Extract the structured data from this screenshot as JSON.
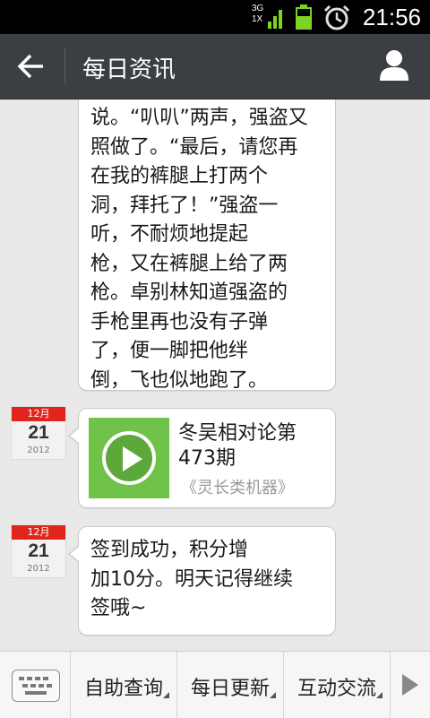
{
  "status_bar": {
    "network": "3G",
    "network_sub": "1X",
    "time": "21:56"
  },
  "header": {
    "title": "每日资讯"
  },
  "messages": [
    {
      "type": "text",
      "text": "说。“叭叭”两声，强盗又\n照做了。“最后，请您再\n在我的裤腿上打两个\n洞，拜托了！”强盗一\n听，不耐烦地提起\n枪，又在裤腿上给了两\n枪。卓别林知道强盗的\n手枪里再也没有子弹\n了，便一脚把他绊\n倒，飞也似地跑了。"
    },
    {
      "type": "article",
      "date": {
        "month": "12月",
        "day": "21",
        "year": "2012"
      },
      "title": "冬吴相对论第473期",
      "source": "《灵长类机器》"
    },
    {
      "type": "text",
      "date": {
        "month": "12月",
        "day": "21",
        "year": "2012"
      },
      "text": "签到成功，积分增\n加10分。明天记得继续\n签哦~"
    }
  ],
  "bottom_menu": {
    "items": [
      "自助查询",
      "每日更新",
      "互动交流"
    ]
  }
}
